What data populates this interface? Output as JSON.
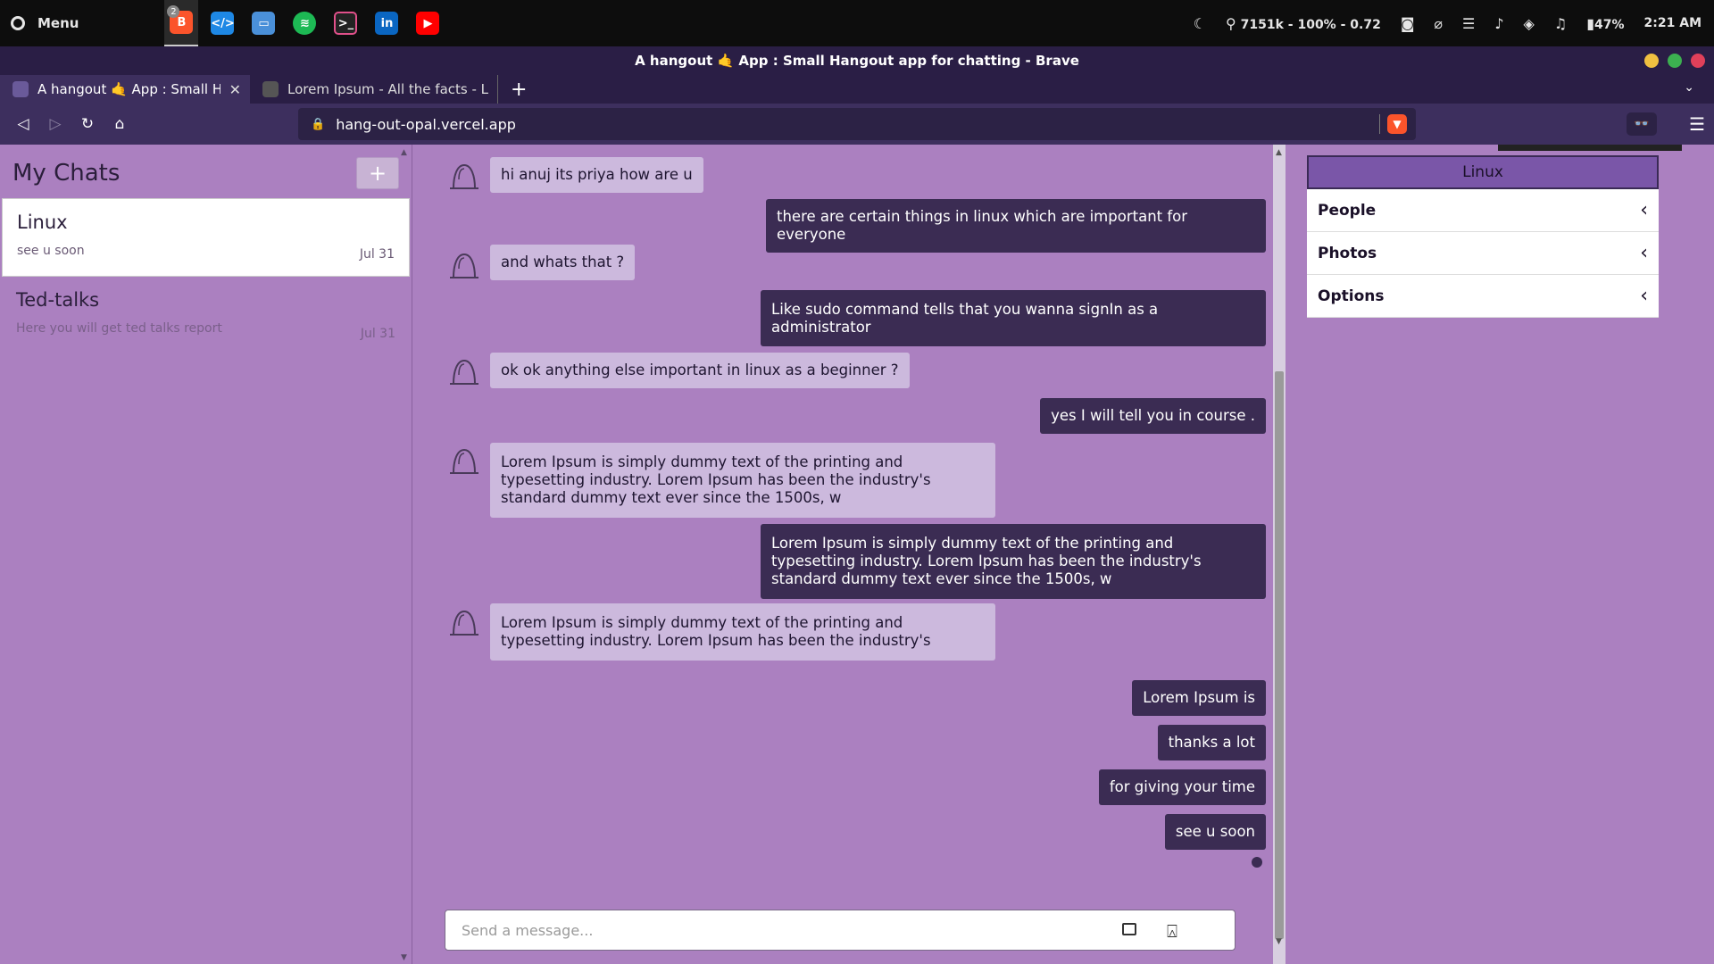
{
  "os_panel": {
    "menu_label": "Menu",
    "apps": [
      {
        "name": "brave-browser-icon",
        "badge": "2",
        "color": "#fb542b"
      },
      {
        "name": "vscode-icon",
        "color": "#1e88e5"
      },
      {
        "name": "files-icon",
        "color": "#4a90d9"
      },
      {
        "name": "spotify-icon",
        "color": "#1db954"
      },
      {
        "name": "terminal-icon",
        "color": "#333333"
      },
      {
        "name": "linkedin-icon",
        "color": "#0a66c2"
      },
      {
        "name": "youtube-icon",
        "color": "#ff0000"
      }
    ],
    "network_stats": "7151k - 100% - 0.72",
    "battery": "47%",
    "time": "2:21 AM"
  },
  "window": {
    "title": "A hangout 🤙 App : Small Hangout app for chatting - Brave"
  },
  "tabs": [
    {
      "label": "A hangout 🤙 App : Small Hangout app for chatting",
      "active": true
    },
    {
      "label": "Lorem Ipsum - All the facts - Lipsum generator",
      "active": false
    }
  ],
  "address_bar": {
    "url": "hang-out-opal.vercel.app"
  },
  "sidebar": {
    "title": "My Chats",
    "add_label": "+",
    "chats": [
      {
        "name": "Linux",
        "last_message": "see u soon",
        "date": "Jul 31",
        "selected": true
      },
      {
        "name": "Ted-talks",
        "last_message": "Here you will get ted talks report",
        "date": "Jul 31",
        "selected": false
      }
    ]
  },
  "messages": [
    {
      "text": "hi anuj its priya how are u",
      "direction": "in"
    },
    {
      "text": "there are certain things in linux which are important for everyone",
      "direction": "out"
    },
    {
      "text": "and whats that ?",
      "direction": "in"
    },
    {
      "text": "Like sudo command tells that you wanna signIn as a administrator",
      "direction": "out"
    },
    {
      "text": "ok ok anything else important in linux as a beginner ?",
      "direction": "in"
    },
    {
      "text": "yes I will tell you in course .",
      "direction": "out"
    },
    {
      "text": "Lorem Ipsum is simply dummy text of the printing and typesetting industry. Lorem Ipsum has been the industry's standard dummy text ever since the 1500s, w",
      "direction": "in"
    },
    {
      "text": "Lorem Ipsum is simply dummy text of the printing and typesetting industry. Lorem Ipsum has been the industry's standard dummy text ever since the 1500s, w",
      "direction": "out"
    },
    {
      "text": "Lorem Ipsum is simply dummy text of the printing and typesetting industry. Lorem Ipsum has been the industry's",
      "direction": "in"
    },
    {
      "text": "Lorem Ipsum is",
      "direction": "out"
    },
    {
      "text": "thanks a lot",
      "direction": "out"
    },
    {
      "text": "for giving your time",
      "direction": "out"
    },
    {
      "text": "see u soon",
      "direction": "out"
    }
  ],
  "composer": {
    "placeholder": "Send a message..."
  },
  "right_panel": {
    "title": "Linux",
    "items": [
      "People",
      "Photos",
      "Options"
    ]
  }
}
